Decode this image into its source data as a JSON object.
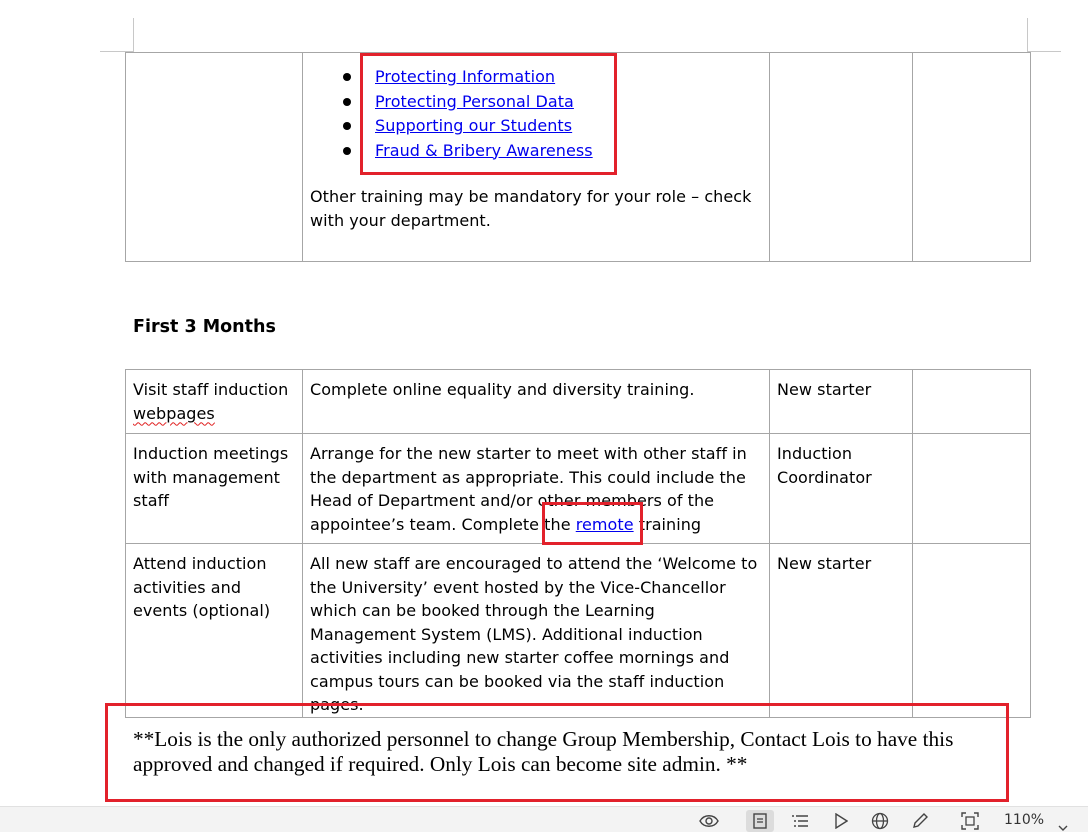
{
  "top_table": {
    "links": [
      "Protecting Information",
      "Protecting Personal Data",
      "Supporting our Students",
      "Fraud & Bribery Awareness"
    ],
    "note": "Other training may be mandatory for your role – check with your department."
  },
  "section_heading": "First 3 Months",
  "months_table": {
    "rows": [
      {
        "activity": "Visit staff induction ",
        "activity_misspelled": "webpages",
        "description": "Complete online equality and diversity training.",
        "owner": "New starter",
        "status": ""
      },
      {
        "activity": "Induction meetings with management staff",
        "description_before": "Arrange for the new starter to meet with other staff in the department as appropriate. This could include the Head of Department and/or other members of the appointee’s team. Complete the ",
        "description_link": "remote",
        "description_after": " training",
        "owner": "Induction Coordinator",
        "status": ""
      },
      {
        "activity": "Attend induction activities and events (optional)",
        "description": "All new staff are encouraged to attend the ‘Welcome to the University’ event hosted by the Vice-Chancellor which can be booked through the Learning Management System (LMS). Additional induction activities including new starter coffee mornings and campus tours can be booked via the staff induction pages.",
        "owner": "New starter",
        "status": ""
      }
    ]
  },
  "note": "**Lois is the only authorized personnel to change Group Membership, Contact Lois to have this approved and changed if required. Only Lois can become site admin. **",
  "status_bar": {
    "icons": [
      "eye-icon",
      "page-view-icon",
      "outline-view-icon",
      "play-icon",
      "globe-icon",
      "pen-icon",
      "fit-page-icon"
    ],
    "zoom": "110%"
  },
  "colors": {
    "link": "#0000ee",
    "highlight_box": "#e2212b",
    "table_border": "#a6a6a6"
  }
}
